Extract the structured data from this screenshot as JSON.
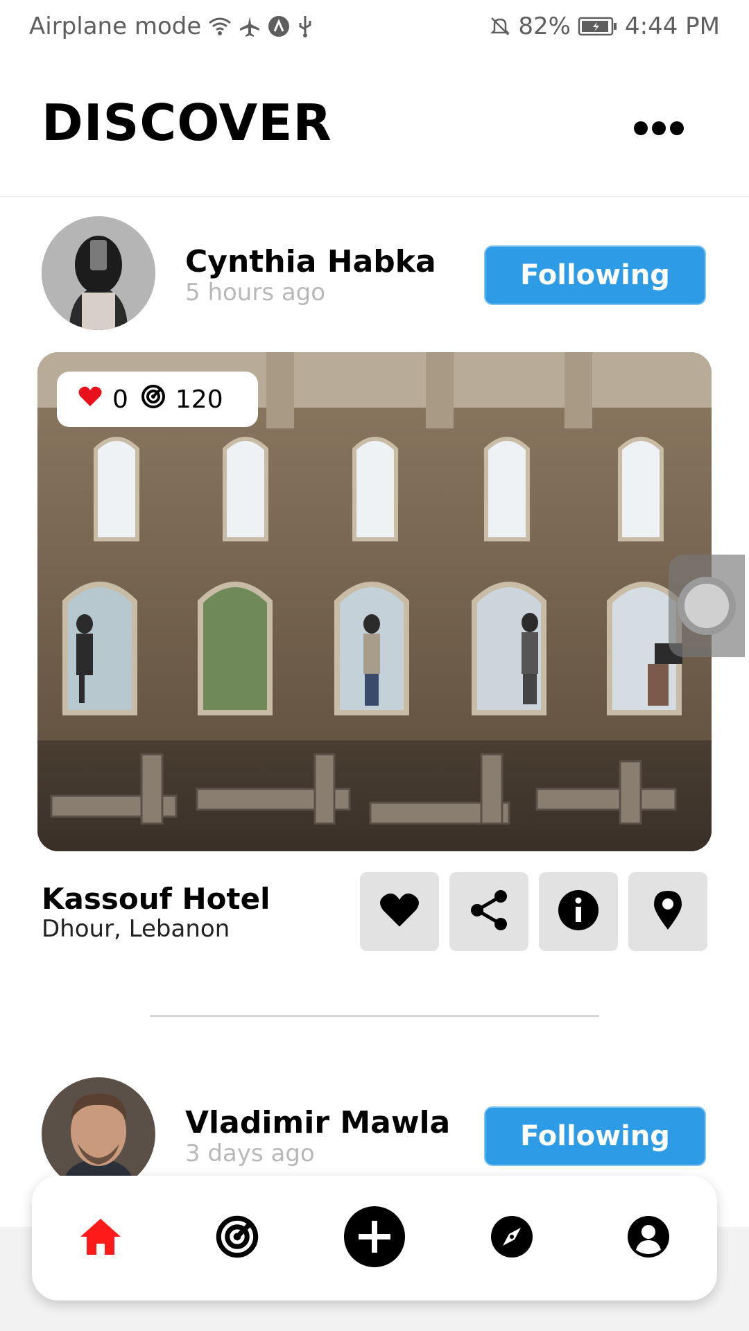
{
  "status_bar": {
    "left_text": "Airplane mode",
    "battery": "82%",
    "time": "4:44 PM"
  },
  "header": {
    "title": "DISCOVER"
  },
  "posts": [
    {
      "user_name": "Cynthia Habka",
      "time_ago": "5 hours ago",
      "follow_label": "Following",
      "likes": "0",
      "views": "120",
      "place_name": "Kassouf Hotel",
      "place_location": "Dhour, Lebanon"
    },
    {
      "user_name": "Vladimir Mawla",
      "time_ago": "3 days ago",
      "follow_label": "Following"
    }
  ],
  "icons": {
    "post_actions": [
      "heart-icon",
      "share-icon",
      "info-icon",
      "location-pin-icon"
    ],
    "nav": [
      "home-icon",
      "radar-icon",
      "add-icon",
      "compass-icon",
      "profile-icon"
    ]
  },
  "colors": {
    "accent": "#2d9be6",
    "active_nav": "#ff1a1a",
    "like": "#e8101a"
  }
}
